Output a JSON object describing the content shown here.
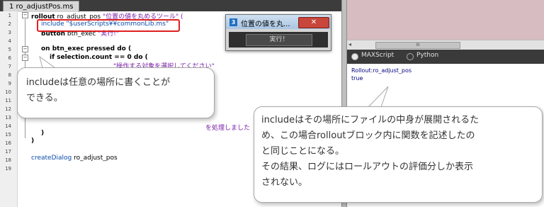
{
  "editor": {
    "tab_label": "1 ro_adjustPos.ms",
    "line_numbers": [
      "1",
      "2",
      "3",
      "4",
      "5",
      "6",
      "7",
      "8",
      "9",
      "10",
      "11",
      "12",
      "13",
      "14",
      "15",
      "16",
      "17",
      "18",
      "19"
    ],
    "code": {
      "l1_kw": "rollout",
      "l1_rest": " ro_adjust_pos ",
      "l1_str": "\"位置の値を丸めるツール\" (",
      "l2": "include \"$userScripts¥¥commonLib.ms\"",
      "l3_kw": "button",
      "l3_rest": " btn_exec ",
      "l3_str": "\"実行!\"",
      "l5": "on btn_exec pressed do (",
      "l6": "if selection.count == 0 do (",
      "l7_str": "\"操作する対象を選択してください\"",
      "l15_str": "を処理しました",
      "l16": ")",
      "l17": ")",
      "l19_fn": "createDialog",
      "l19_rest": " ro_adjust_pos"
    }
  },
  "dialog": {
    "icon_text": "3",
    "title": "位置の値を丸...",
    "close_label": "✕",
    "run_label": "実行！"
  },
  "right_panel": {
    "scroll_left": "◂",
    "scroll_thumb": "III",
    "lang_maxscript": "MAXScript",
    "lang_python": "Python",
    "listener_lines": [
      "Rollout:ro_adjust_pos",
      "true"
    ]
  },
  "callouts": {
    "c1_lines": [
      "includeは任意の場所に書くことが",
      "できる。"
    ],
    "c2_lines": [
      "includeはその場所にファイルの中身が展開されるた",
      "め、この場合rolloutブロック内に関数を記述したの",
      "と同じことになる。",
      "その結果、ログにはロールアウトの評価分しか表示",
      "されない。"
    ]
  }
}
